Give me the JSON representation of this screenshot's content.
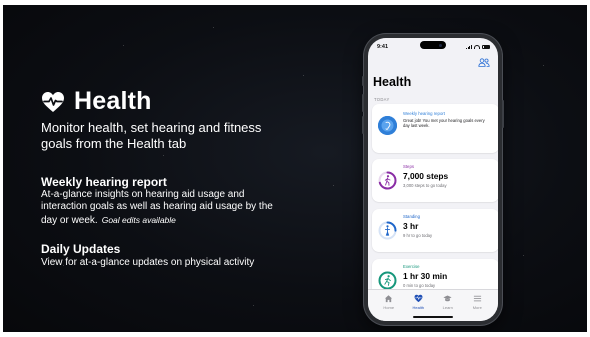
{
  "slide": {
    "title": "Health",
    "subtitle": "Monitor health, set hearing and fitness goals from the Health tab",
    "sections": [
      {
        "title": "Weekly hearing report",
        "body": "At-a-glance insights on hearing aid usage and interaction goals as well as hearing aid usage by the day or week.",
        "note": "Goal edits available"
      },
      {
        "title": "Daily Updates",
        "body": "View for at-a-glance updates on physical activity",
        "note": ""
      }
    ]
  },
  "phone": {
    "status_time": "9:41",
    "app_title": "Health",
    "section_label": "TODAY",
    "cards": [
      {
        "label": "Weekly hearing report",
        "text": "Great job! You met your hearing goals every day last week.",
        "accent": "#2f7fd8",
        "icon": "ear-icon"
      },
      {
        "label": "Steps",
        "value": "7,000 steps",
        "sub": "3,000 steps to go today",
        "progress": 0.7,
        "accent": "#8a2da5",
        "icon": "walk-icon"
      },
      {
        "label": "Standing",
        "value": "3 hr",
        "sub": "9 hr to go today",
        "progress": 0.25,
        "accent": "#1f66c9",
        "icon": "stand-icon"
      },
      {
        "label": "Exercise",
        "value": "1 hr 30 min",
        "sub": "0 min to go today",
        "progress": 1.0,
        "accent": "#17977c",
        "icon": "run-icon"
      }
    ],
    "tabs": [
      {
        "label": "Home",
        "icon": "home-icon",
        "active": false
      },
      {
        "label": "Health",
        "icon": "heart-icon",
        "active": true
      },
      {
        "label": "Learn",
        "icon": "graduation-cap-icon",
        "active": false
      },
      {
        "label": "More",
        "icon": "menu-icon",
        "active": false
      }
    ]
  },
  "colors": {
    "background": "#0c0e13",
    "text": "#ffffff",
    "accent_blue": "#1f4fb5",
    "steps_purple": "#8a2da5",
    "exercise_teal": "#17977c"
  }
}
